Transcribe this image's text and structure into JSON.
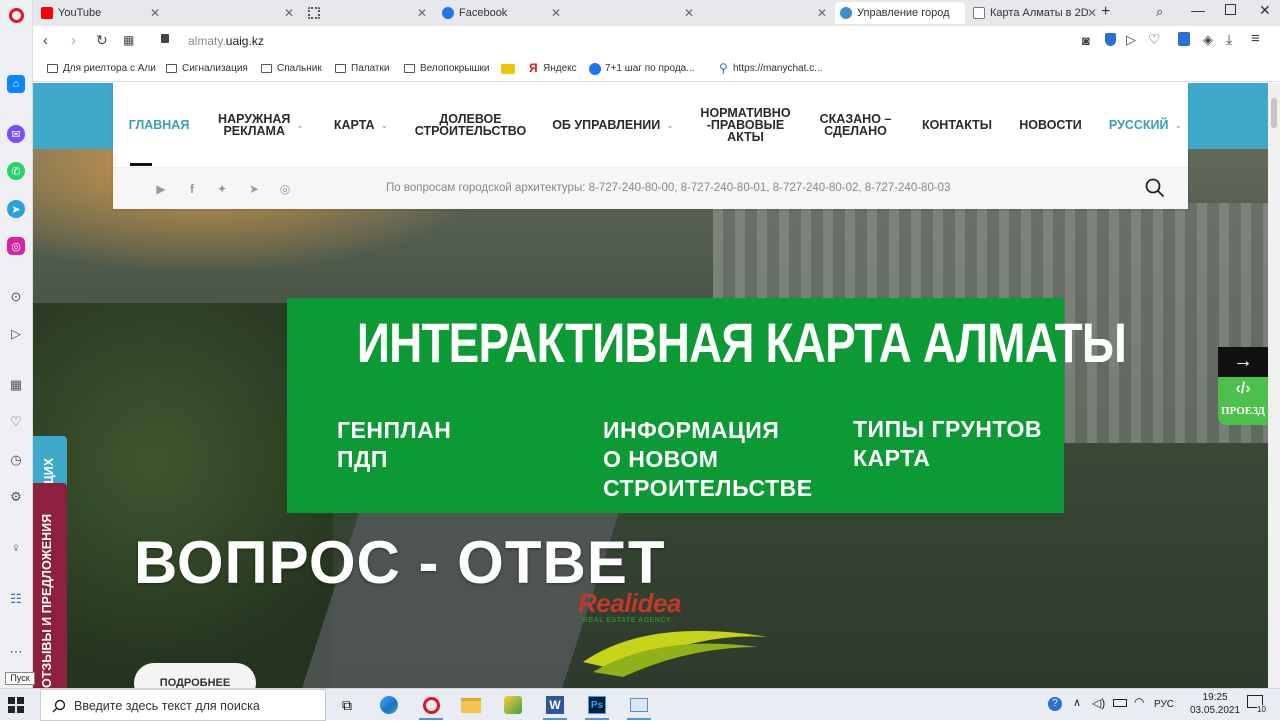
{
  "browser": {
    "tabs": [
      {
        "label": "YouTube",
        "icon": "youtube-icon",
        "color": "#ff0000"
      },
      {
        "label": "",
        "icon": "blank-tab-icon",
        "color": "#cccccc"
      },
      {
        "label": "",
        "icon": "grid-tab-icon",
        "color": "#666666"
      },
      {
        "label": "Facebook",
        "icon": "facebook-icon",
        "color": "#1877f2"
      },
      {
        "label": "",
        "icon": "blank-tab-icon",
        "color": "#cccccc"
      },
      {
        "label": "",
        "icon": "blank-tab-icon",
        "color": "#cccccc"
      },
      {
        "label": "Управление город",
        "icon": "uaig-icon",
        "color": "#3b8fd1"
      },
      {
        "label": "Карта Алматы в 2D",
        "icon": "page-icon",
        "color": "#888888"
      }
    ],
    "url_host": "almaty.",
    "url_domain": "uaig.kz",
    "bookmarks": [
      "Для риелтора с Али",
      "Сигнализация",
      "Спальник",
      "Палатки",
      "Велопокрышки",
      "Яндекс",
      "7+1 шаг по прода...",
      "https://manychat.c..."
    ]
  },
  "site": {
    "nav": [
      {
        "label": "ГЛАВНАЯ",
        "active": true
      },
      {
        "label": "НАРУЖНАЯ\nРЕКЛАМА",
        "dropdown": true
      },
      {
        "label": "КАРТА",
        "dropdown": true
      },
      {
        "label": "ДОЛЕВОЕ\nСТРОИТЕЛЬСТВО"
      },
      {
        "label": "ОБ УПРАВЛЕНИИ",
        "dropdown": true
      },
      {
        "label": "НОРМАТИВНО\n-ПРАВОВЫЕ\nАКТЫ"
      },
      {
        "label": "СКАЗАНО –\nСДЕЛАНО"
      },
      {
        "label": "КОНТАКТЫ"
      },
      {
        "label": "НОВОСТИ"
      },
      {
        "label": "РУССКИЙ",
        "dropdown": true
      }
    ],
    "phones": "По вопросам городской архитектуры: 8-727-240-80-00, 8-727-240-80-01, 8-727-240-80-02, 8-727-240-80-03",
    "banner": {
      "title": "ИНТЕРАКТИВНАЯ КАРТА АЛМАТЫ",
      "col1": "ГЕНПЛАН\nПДП",
      "col2": "ИНФОРМАЦИЯ\nО НОВОМ\nСТРОИТЕЛЬСТВЕ",
      "col3": "ТИПЫ ГРУНТОВ\nКАРТА"
    },
    "hero_title": "ВОПРОС - ОТВЕТ",
    "more_button": "ПОДРОБНЕЕ",
    "logo_name": "Realidea",
    "logo_tagline": "REAL ESTATE AGENCY",
    "feedback_tab": "ОТЗЫВЫ И ПРЕДЛОЖЕНИЯ",
    "teal_tab": "ЩИХ",
    "proezd_label": "ПРОЕЗД",
    "arrow": "→",
    "colors": {
      "accent": "#3a9ec0",
      "banner_green": "#0c9a34",
      "feedback": "#8f1f3f"
    }
  },
  "taskbar": {
    "search_placeholder": "Введите здесь текст для поиска",
    "lang": "РУС",
    "time": "19:25",
    "date": "03.05.2021",
    "notifications": "10",
    "pusk": "Пуск"
  }
}
